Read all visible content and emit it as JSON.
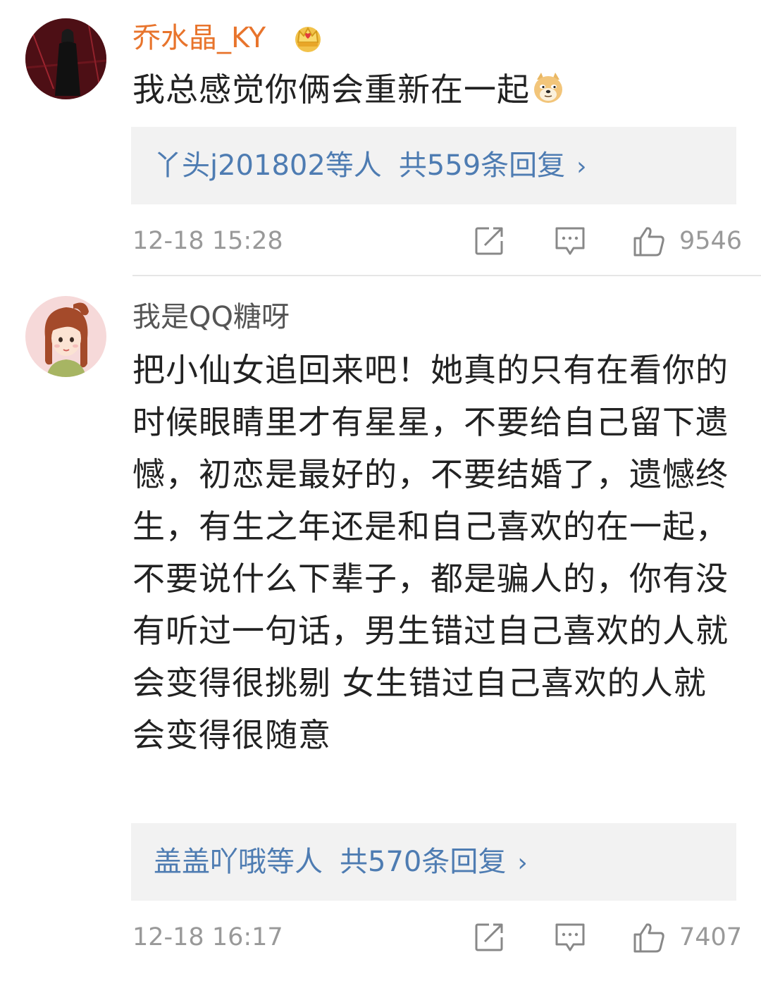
{
  "comments": [
    {
      "username": "乔水晶_KY",
      "badge_icon": "crown-icon",
      "text": "我总感觉你俩会重新在一起",
      "emoji_icon": "doge-emoji-icon",
      "replies": {
        "who": "丫头j201802等人",
        "total": "共559条回复",
        "chevron": "›"
      },
      "timestamp": "12-18 15:28",
      "likes": "9546"
    },
    {
      "username": "我是QQ糖呀",
      "text": "把小仙女追回来吧！她真的只有在看你的时候眼睛里才有星星，不要给自己留下遗憾，初恋是最好的，不要结婚了，遗憾终生，有生之年还是和自己喜欢的在一起，不要说什么下辈子，都是骗人的，你有没有听过一句话，男生错过自己喜欢的人就会变得很挑剔 女生错过自己喜欢的人就会变得很随意",
      "replies": {
        "who": "盖盖吖哦等人",
        "total": "共570条回复",
        "chevron": "›"
      },
      "timestamp": "12-18 16:17",
      "likes": "7407"
    }
  ],
  "colors": {
    "username_vip": "#e8742c",
    "username_normal": "#555555",
    "link_blue": "#4e7cb2",
    "reply_bg": "#f2f2f2",
    "meta_gray": "#999999"
  }
}
